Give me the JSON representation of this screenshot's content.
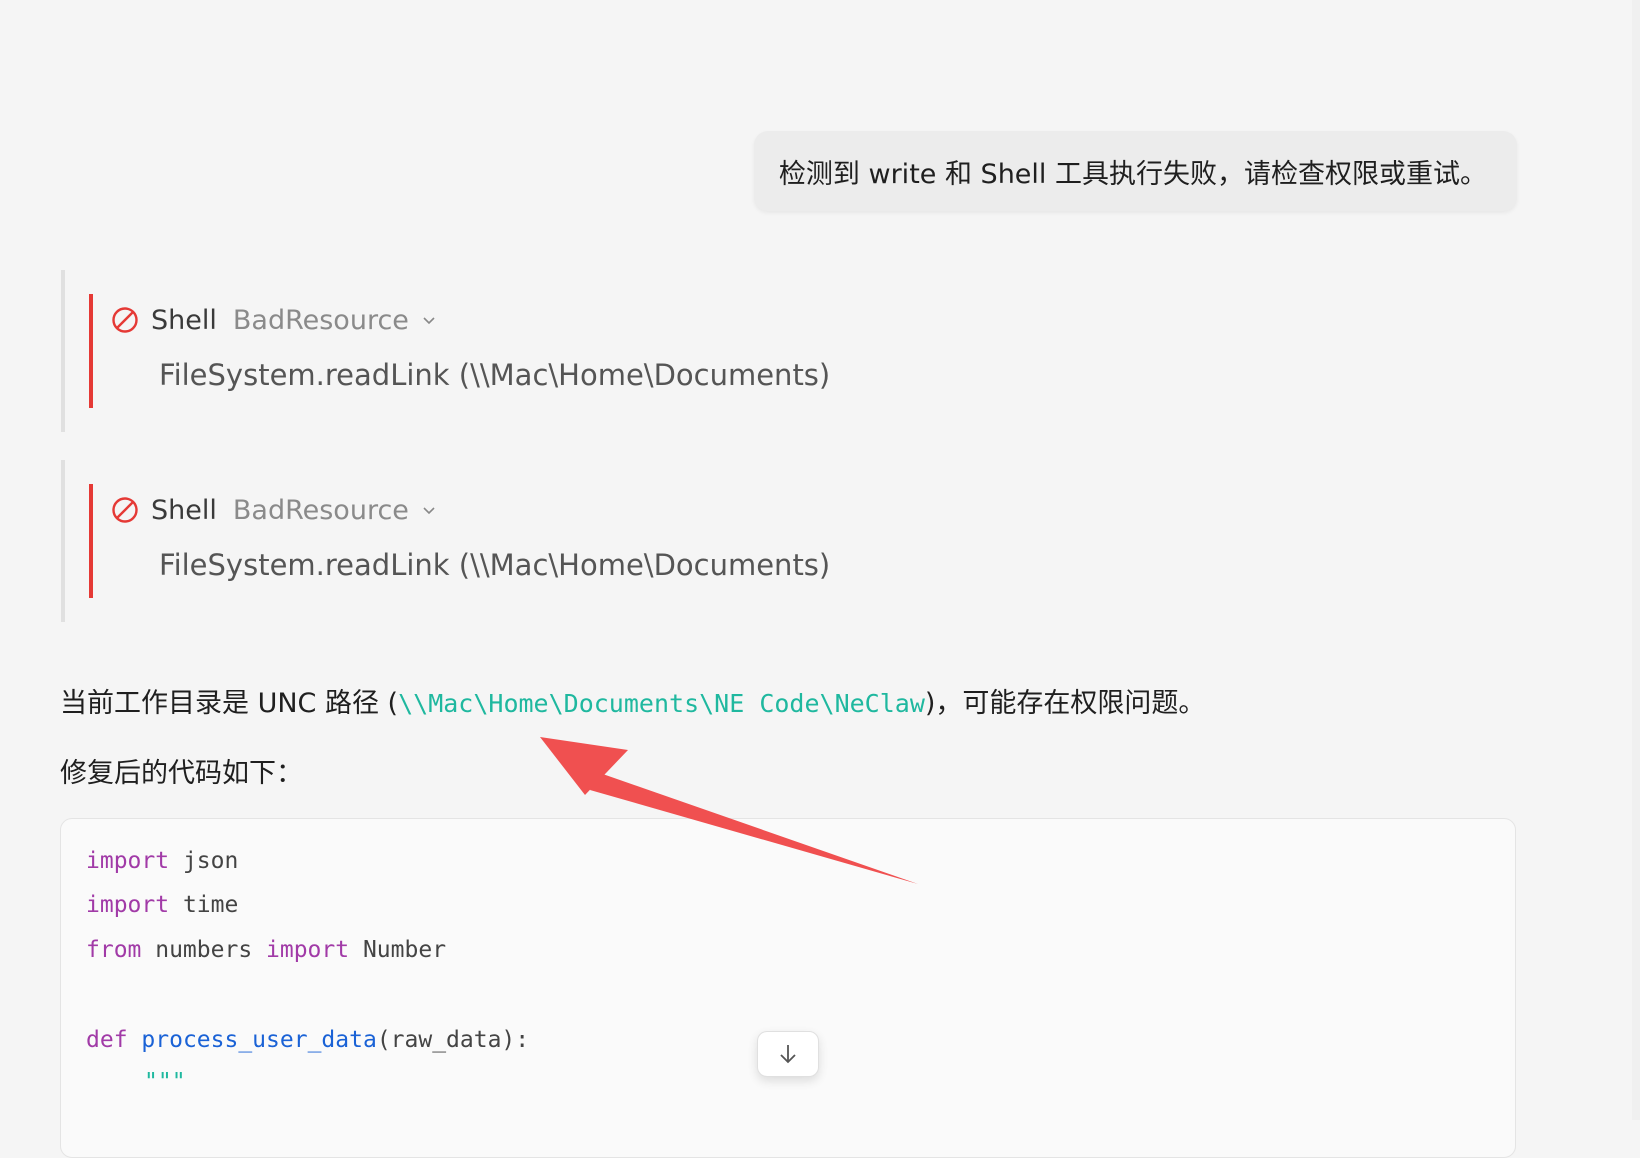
{
  "user_message": {
    "text": "检测到 write 和 Shell 工具执行失败，请检查权限或重试。"
  },
  "tool_calls": [
    {
      "icon": "ban-icon",
      "name": "Shell",
      "status": "BadResource",
      "detail": "FileSystem.readLink (\\\\Mac\\Home\\Documents)",
      "accent_color": "#e53935"
    },
    {
      "icon": "ban-icon",
      "name": "Shell",
      "status": "BadResource",
      "detail": "FileSystem.readLink (\\\\Mac\\Home\\Documents)",
      "accent_color": "#e53935"
    }
  ],
  "assistant": {
    "para1_prefix": "当前工作目录是 UNC 路径 (",
    "para1_code": "\\\\Mac\\Home\\Documents\\NE Code\\NeClaw",
    "para1_suffix": ")，可能存在权限问题。",
    "para2": "修复后的代码如下："
  },
  "code": {
    "line1_kw": "import",
    "line1_rest": " json",
    "line2_kw": "import",
    "line2_rest": " time",
    "line3_kw1": "from",
    "line3_mid": " numbers ",
    "line3_kw2": "import",
    "line3_rest": " Number",
    "line5_kw": "def",
    "line5_fn": "process_user_data",
    "line5_rest": "(raw_data):",
    "line6_str": "\"\"\""
  },
  "scroll_button": {
    "icon": "arrow-down-icon"
  },
  "annotation": {
    "color": "#f05050"
  }
}
